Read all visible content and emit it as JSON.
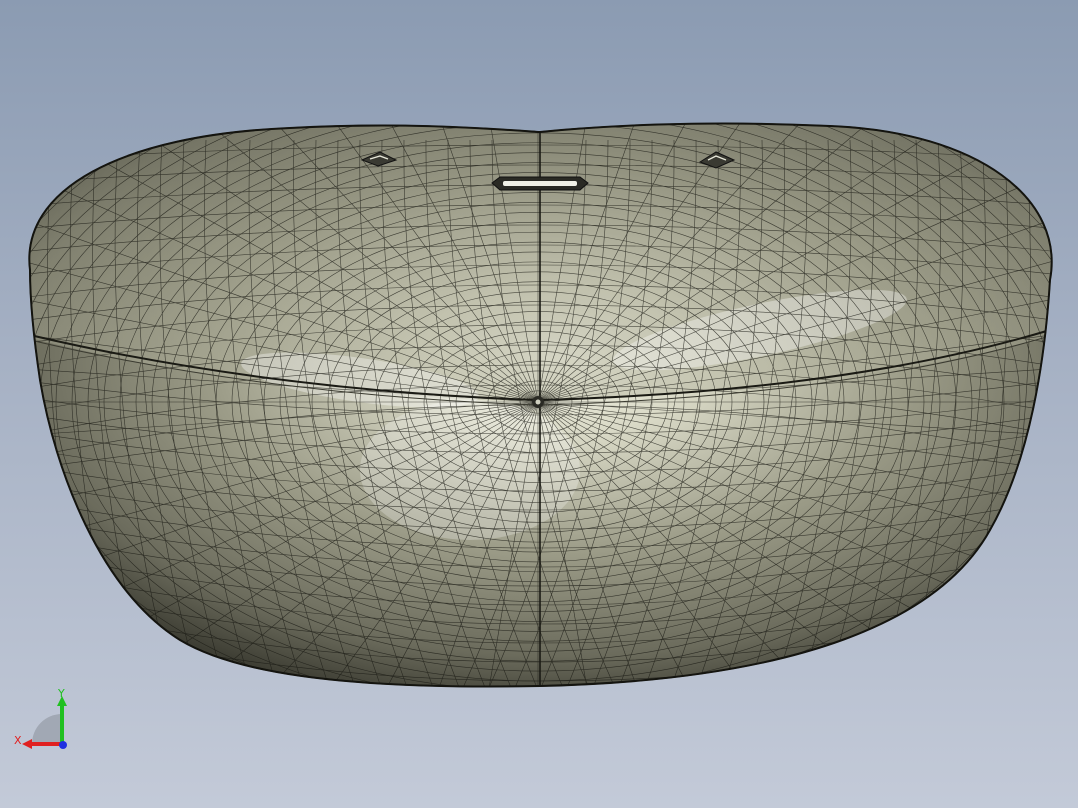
{
  "viewport": {
    "background_top": "#8b9bb2",
    "background_bottom": "#c3cad8"
  },
  "model": {
    "render_mode": "shaded-with-mesh-edges",
    "surface_color": "#c9c9b4",
    "edge_color": "#1a1a14",
    "slot_icon": "slot-opening-icon",
    "vent_icons": [
      "left-vent-icon",
      "right-vent-icon"
    ]
  },
  "triad": {
    "x_label": "X",
    "y_label": "Y",
    "x_color": "#e02020",
    "y_color": "#20c020",
    "z_color": "#2030e0"
  }
}
